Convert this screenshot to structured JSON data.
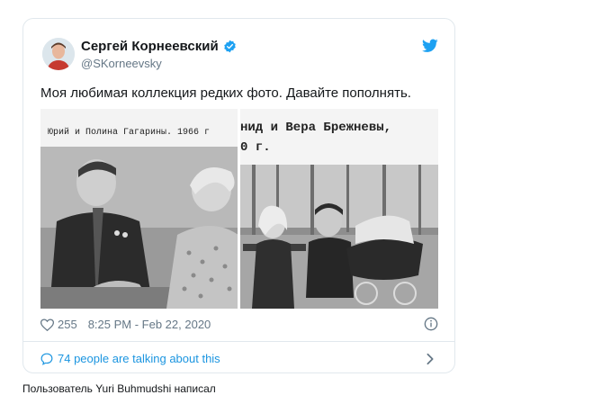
{
  "tweet": {
    "author_name": "Сергей Корнеевский",
    "author_handle": "@SKorneevsky",
    "text": "Моя любимая коллекция редких фото. Давайте пополнять.",
    "image_caption_left": "Юрий и Полина Гагарины. 1966 г",
    "image_caption_right_line1": "нид и Вера Брежневы,",
    "image_caption_right_line2": "0 г.",
    "likes": "255",
    "timestamp": "8:25 PM - Feb 22, 2020",
    "talking": "74 people are talking about this"
  },
  "below_text": "Пользователь Yuri Buhmudshi написал",
  "colors": {
    "link_blue": "#1b95e0",
    "verified_blue": "#1da1f2",
    "meta_gray": "#657786",
    "border": "#e1e8ed"
  },
  "icons": {
    "verified": "verified-badge-icon",
    "bird": "twitter-bird-icon",
    "like": "heart-icon",
    "info": "info-icon",
    "talk": "speech-bubble-icon",
    "chevron": "chevron-right-icon"
  }
}
